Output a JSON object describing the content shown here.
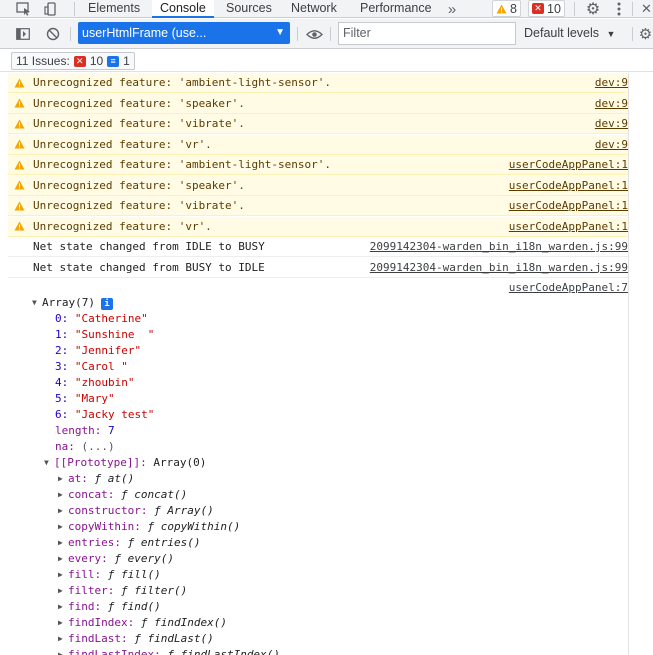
{
  "tabs": [
    {
      "label": "Elements"
    },
    {
      "label": "Console",
      "active": true
    },
    {
      "label": "Sources"
    },
    {
      "label": "Network"
    },
    {
      "label": "Performance"
    }
  ],
  "more_tabs_icon": "double-chevron-right",
  "badges": {
    "warnings": "8",
    "errors": "10"
  },
  "toolbar": {
    "context_select": "userHtmlFrame (use...",
    "filter_placeholder": "Filter",
    "levels_label": "Default levels"
  },
  "issues": {
    "label": "11 Issues:",
    "errors": "10",
    "infos": "1"
  },
  "messages": [
    {
      "type": "warn",
      "text": "Unrecognized feature: 'ambient-light-sensor'.",
      "source": "dev:9"
    },
    {
      "type": "warn",
      "text": "Unrecognized feature: 'speaker'.",
      "source": "dev:9"
    },
    {
      "type": "warn",
      "text": "Unrecognized feature: 'vibrate'.",
      "source": "dev:9"
    },
    {
      "type": "warn",
      "text": "Unrecognized feature: 'vr'.",
      "source": "dev:9"
    },
    {
      "type": "warn",
      "text": "Unrecognized feature: 'ambient-light-sensor'.",
      "source": "userCodeAppPanel:1"
    },
    {
      "type": "warn",
      "text": "Unrecognized feature: 'speaker'.",
      "source": "userCodeAppPanel:1"
    },
    {
      "type": "warn",
      "text": "Unrecognized feature: 'vibrate'.",
      "source": "userCodeAppPanel:1"
    },
    {
      "type": "warn",
      "text": "Unrecognized feature: 'vr'.",
      "source": "userCodeAppPanel:1"
    },
    {
      "type": "info",
      "text": "Net state changed from IDLE to BUSY",
      "source": "2099142304-warden_bin_i18n_warden.js:99"
    },
    {
      "type": "info",
      "text": "Net state changed from BUSY to IDLE",
      "source": "2099142304-warden_bin_i18n_warden.js:99"
    }
  ],
  "array_log": {
    "source": "userCodeAppPanel:7",
    "header": "Array(7)",
    "items": [
      {
        "index": "0:",
        "value": "\"Catherine\""
      },
      {
        "index": "1:",
        "value": "\"Sunshine  \""
      },
      {
        "index": "2:",
        "value": "\"Jennifer\""
      },
      {
        "index": "3:",
        "value": "\"Carol \""
      },
      {
        "index": "4:",
        "value": "\"zhoubin\""
      },
      {
        "index": "5:",
        "value": "\"Mary\""
      },
      {
        "index": "6:",
        "value": "\"Jacky test\""
      }
    ],
    "length_key": "length:",
    "length_value": "7",
    "na_key": "na:",
    "na_value": "(...)",
    "prototype_key": "[[Prototype]]:",
    "prototype_value": "Array(0)",
    "methods": [
      {
        "key": "at:",
        "value": "ƒ at()"
      },
      {
        "key": "concat:",
        "value": "ƒ concat()"
      },
      {
        "key": "constructor:",
        "value": "ƒ Array()"
      },
      {
        "key": "copyWithin:",
        "value": "ƒ copyWithin()"
      },
      {
        "key": "entries:",
        "value": "ƒ entries()"
      },
      {
        "key": "every:",
        "value": "ƒ every()"
      },
      {
        "key": "fill:",
        "value": "ƒ fill()"
      },
      {
        "key": "filter:",
        "value": "ƒ filter()"
      },
      {
        "key": "find:",
        "value": "ƒ find()"
      },
      {
        "key": "findIndex:",
        "value": "ƒ findIndex()"
      },
      {
        "key": "findLast:",
        "value": "ƒ findLast()"
      },
      {
        "key": "findLastIndex:",
        "value": "ƒ findLastIndex()"
      }
    ]
  },
  "colors": {
    "accent": "#1a73e8",
    "warning_bg": "#fffbe5",
    "error": "#d93025"
  }
}
